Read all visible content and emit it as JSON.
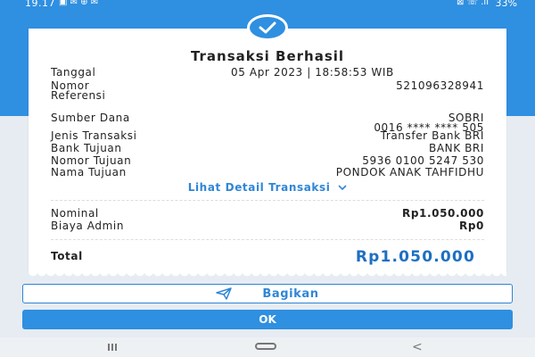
{
  "status_bar": {
    "time": "19.17",
    "notif_icons": "▣ ✉ ⊕ ✉",
    "sys_icons": "⊠ ☏ .ıl",
    "battery": "33%"
  },
  "receipt": {
    "title": "Transaksi Berhasil",
    "tanggal": {
      "label": "Tanggal",
      "value": "05 Apr 2023 | 18:58:53 WIB"
    },
    "nomor_referensi": {
      "label_line1": "Nomor",
      "label_line2": "Referensi",
      "value": "521096328941"
    },
    "sumber_dana": {
      "label": "Sumber Dana",
      "value_line1": "SOBRI",
      "value_line2": "0016 **** **** 505"
    },
    "jenis_transaksi": {
      "label": "Jenis Transaksi",
      "value": "Transfer Bank BRI"
    },
    "bank_tujuan": {
      "label": "Bank Tujuan",
      "value": "BANK BRI"
    },
    "nomor_tujuan": {
      "label": "Nomor Tujuan",
      "value": "5936 0100 5247 530"
    },
    "nama_tujuan": {
      "label": "Nama Tujuan",
      "value": "PONDOK ANAK TAHFIDHU"
    },
    "detail_link": "Lihat Detail Transaksi",
    "nominal": {
      "label": "Nominal",
      "value": "Rp1.050.000"
    },
    "biaya_admin": {
      "label": "Biaya Admin",
      "value": "Rp0"
    },
    "total": {
      "label": "Total",
      "value": "Rp1.050.000"
    }
  },
  "actions": {
    "share_label": "Bagikan",
    "ok_label": "OK"
  },
  "colors": {
    "primary": "#2f8fe0",
    "total_text": "#1d6fc2"
  },
  "icons": {
    "check": "check-icon",
    "share": "send-icon",
    "chevron": "chevron-down-icon"
  }
}
